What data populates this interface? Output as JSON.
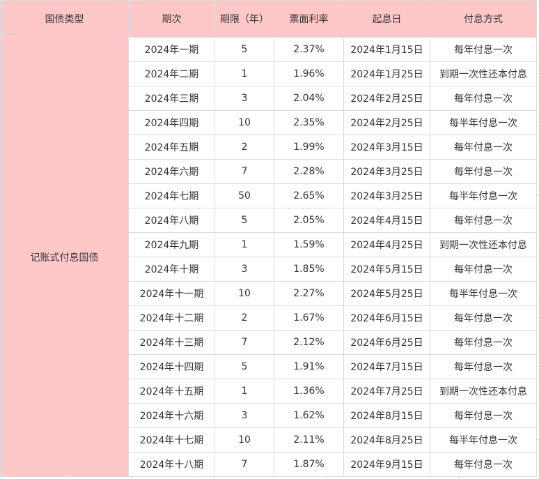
{
  "table": {
    "headers": [
      "国债类型",
      "期次",
      "期限（年）",
      "票面利率",
      "起息日",
      "付息方式"
    ],
    "bond_type": "记账式付息国债",
    "rows": [
      {
        "period": "2024年一期",
        "term": "5",
        "rate": "2.37%",
        "start_date": "2024年1月15日",
        "payment": "每年付息一次"
      },
      {
        "period": "2024年二期",
        "term": "1",
        "rate": "1.96%",
        "start_date": "2024年1月25日",
        "payment": "到期一次性还本付息"
      },
      {
        "period": "2024年三期",
        "term": "3",
        "rate": "2.04%",
        "start_date": "2024年2月25日",
        "payment": "每年付息一次"
      },
      {
        "period": "2024年四期",
        "term": "10",
        "rate": "2.35%",
        "start_date": "2024年2月25日",
        "payment": "每半年付息一次"
      },
      {
        "period": "2024年五期",
        "term": "2",
        "rate": "1.99%",
        "start_date": "2024年3月15日",
        "payment": "每年付息一次"
      },
      {
        "period": "2024年六期",
        "term": "7",
        "rate": "2.28%",
        "start_date": "2024年3月25日",
        "payment": "每年付息一次"
      },
      {
        "period": "2024年七期",
        "term": "50",
        "rate": "2.65%",
        "start_date": "2024年3月25日",
        "payment": "每半年付息一次"
      },
      {
        "period": "2024年八期",
        "term": "5",
        "rate": "2.05%",
        "start_date": "2024年4月15日",
        "payment": "每年付息一次"
      },
      {
        "period": "2024年九期",
        "term": "1",
        "rate": "1.59%",
        "start_date": "2024年4月25日",
        "payment": "到期一次性还本付息"
      },
      {
        "period": "2024年十期",
        "term": "3",
        "rate": "1.85%",
        "start_date": "2024年5月15日",
        "payment": "每年付息一次"
      },
      {
        "period": "2024年十一期",
        "term": "10",
        "rate": "2.27%",
        "start_date": "2024年5月25日",
        "payment": "每半年付息一次"
      },
      {
        "period": "2024年十二期",
        "term": "2",
        "rate": "1.67%",
        "start_date": "2024年6月15日",
        "payment": "每年付息一次"
      },
      {
        "period": "2024年十三期",
        "term": "7",
        "rate": "2.12%",
        "start_date": "2024年6月25日",
        "payment": "每年付息一次"
      },
      {
        "period": "2024年十四期",
        "term": "5",
        "rate": "1.91%",
        "start_date": "2024年7月15日",
        "payment": "每年付息一次"
      },
      {
        "period": "2024年十五期",
        "term": "1",
        "rate": "1.36%",
        "start_date": "2024年7月25日",
        "payment": "到期一次性还本付息"
      },
      {
        "period": "2024年十六期",
        "term": "3",
        "rate": "1.62%",
        "start_date": "2024年8月15日",
        "payment": "每年付息一次"
      },
      {
        "period": "2024年十七期",
        "term": "10",
        "rate": "2.11%",
        "start_date": "2024年8月25日",
        "payment": "每半年付息一次"
      },
      {
        "period": "2024年十八期",
        "term": "7",
        "rate": "1.87%",
        "start_date": "2024年9月15日",
        "payment": "每年付息一次"
      }
    ]
  },
  "colors": {
    "header_fill": "#ffc8c8",
    "type_fill": "#ffc8c8",
    "grid_line": "#dcdcdc"
  }
}
